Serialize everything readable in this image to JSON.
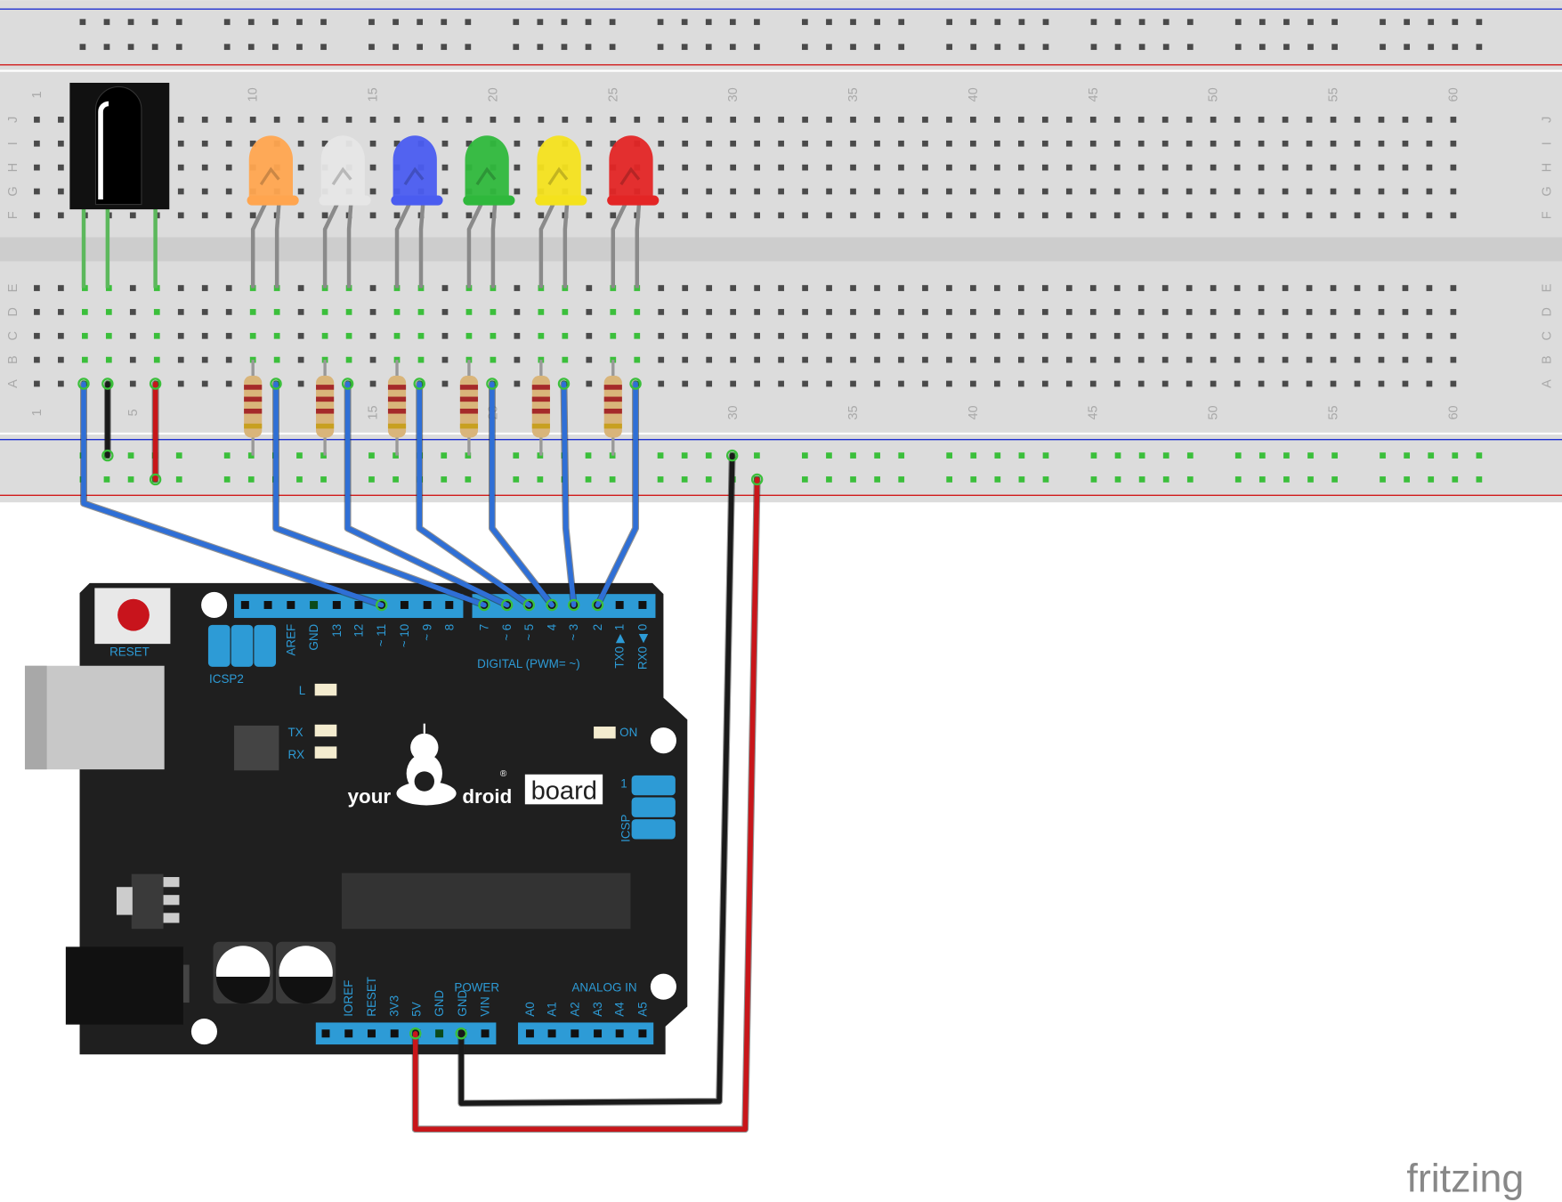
{
  "breadboard": {
    "rows_top": [
      "J",
      "I",
      "H",
      "G",
      "F"
    ],
    "rows_bottom": [
      "E",
      "D",
      "C",
      "B",
      "A"
    ],
    "column_labels": [
      "1",
      "5",
      "10",
      "15",
      "20",
      "25",
      "30",
      "35",
      "40",
      "45",
      "50",
      "55",
      "60"
    ],
    "columns": 60,
    "colors": {
      "body": "#dcdcdc",
      "rail_blue": "#1e2fd0",
      "rail_red": "#d11a1a",
      "connected_hole": "#3bbf3b"
    }
  },
  "components": {
    "leds": [
      {
        "color": "orange",
        "hex": "#ffa54f"
      },
      {
        "color": "white",
        "hex": "#e6e6e6"
      },
      {
        "color": "blue",
        "hex": "#4a5cf0"
      },
      {
        "color": "green",
        "hex": "#2fb83c"
      },
      {
        "color": "yellow",
        "hex": "#f4e21d"
      },
      {
        "color": "red",
        "hex": "#e32525"
      }
    ],
    "ir_receiver": {
      "color": "#111111"
    }
  },
  "board": {
    "reset_label": "RESET",
    "icsp2_label": "ICSP2",
    "l_label": "L",
    "tx_label": "TX",
    "rx_label": "RX",
    "on_label": "ON",
    "logo_your": "your",
    "logo_droid": "droid",
    "logo_board": "board",
    "registered": "®",
    "icsp_label": "ICSP",
    "icsp_pin1": "1",
    "digital_label": "DIGITAL  (PWM=    ~)",
    "power_label": "POWER",
    "analog_label": "ANALOG  IN",
    "digital_pins_left": [
      "AREF",
      "GND",
      "13",
      "12",
      "~ 11",
      "~ 10",
      "~ 9",
      "8"
    ],
    "digital_pins_right": [
      "7",
      "~ 6",
      "~ 5",
      "4",
      "~ 3",
      "2",
      "TX0 ▶ 1",
      "RX0 ◀ 0"
    ],
    "power_pins": [
      "IOREF",
      "RESET",
      "3V3",
      "5V",
      "GND",
      "GND",
      "VIN"
    ],
    "analog_pins": [
      "A0",
      "A1",
      "A2",
      "A3",
      "A4",
      "A5"
    ]
  },
  "wires": [
    {
      "from": "IR receiver out",
      "to": "~ 11",
      "color": "#2f6fd6"
    },
    {
      "from": "orange LED",
      "to": "7",
      "color": "#2f6fd6"
    },
    {
      "from": "white LED",
      "to": "~ 6",
      "color": "#2f6fd6"
    },
    {
      "from": "blue LED",
      "to": "~ 5",
      "color": "#2f6fd6"
    },
    {
      "from": "green LED",
      "to": "4",
      "color": "#2f6fd6"
    },
    {
      "from": "yellow LED",
      "to": "~ 3",
      "color": "#2f6fd6"
    },
    {
      "from": "red LED",
      "to": "2",
      "color": "#2f6fd6"
    },
    {
      "from": "breadboard GND rail",
      "to": "GND",
      "color": "#1a1a1a"
    },
    {
      "from": "breadboard 5V rail",
      "to": "5V",
      "color": "#c8161a"
    }
  ],
  "watermark": "fritzing"
}
